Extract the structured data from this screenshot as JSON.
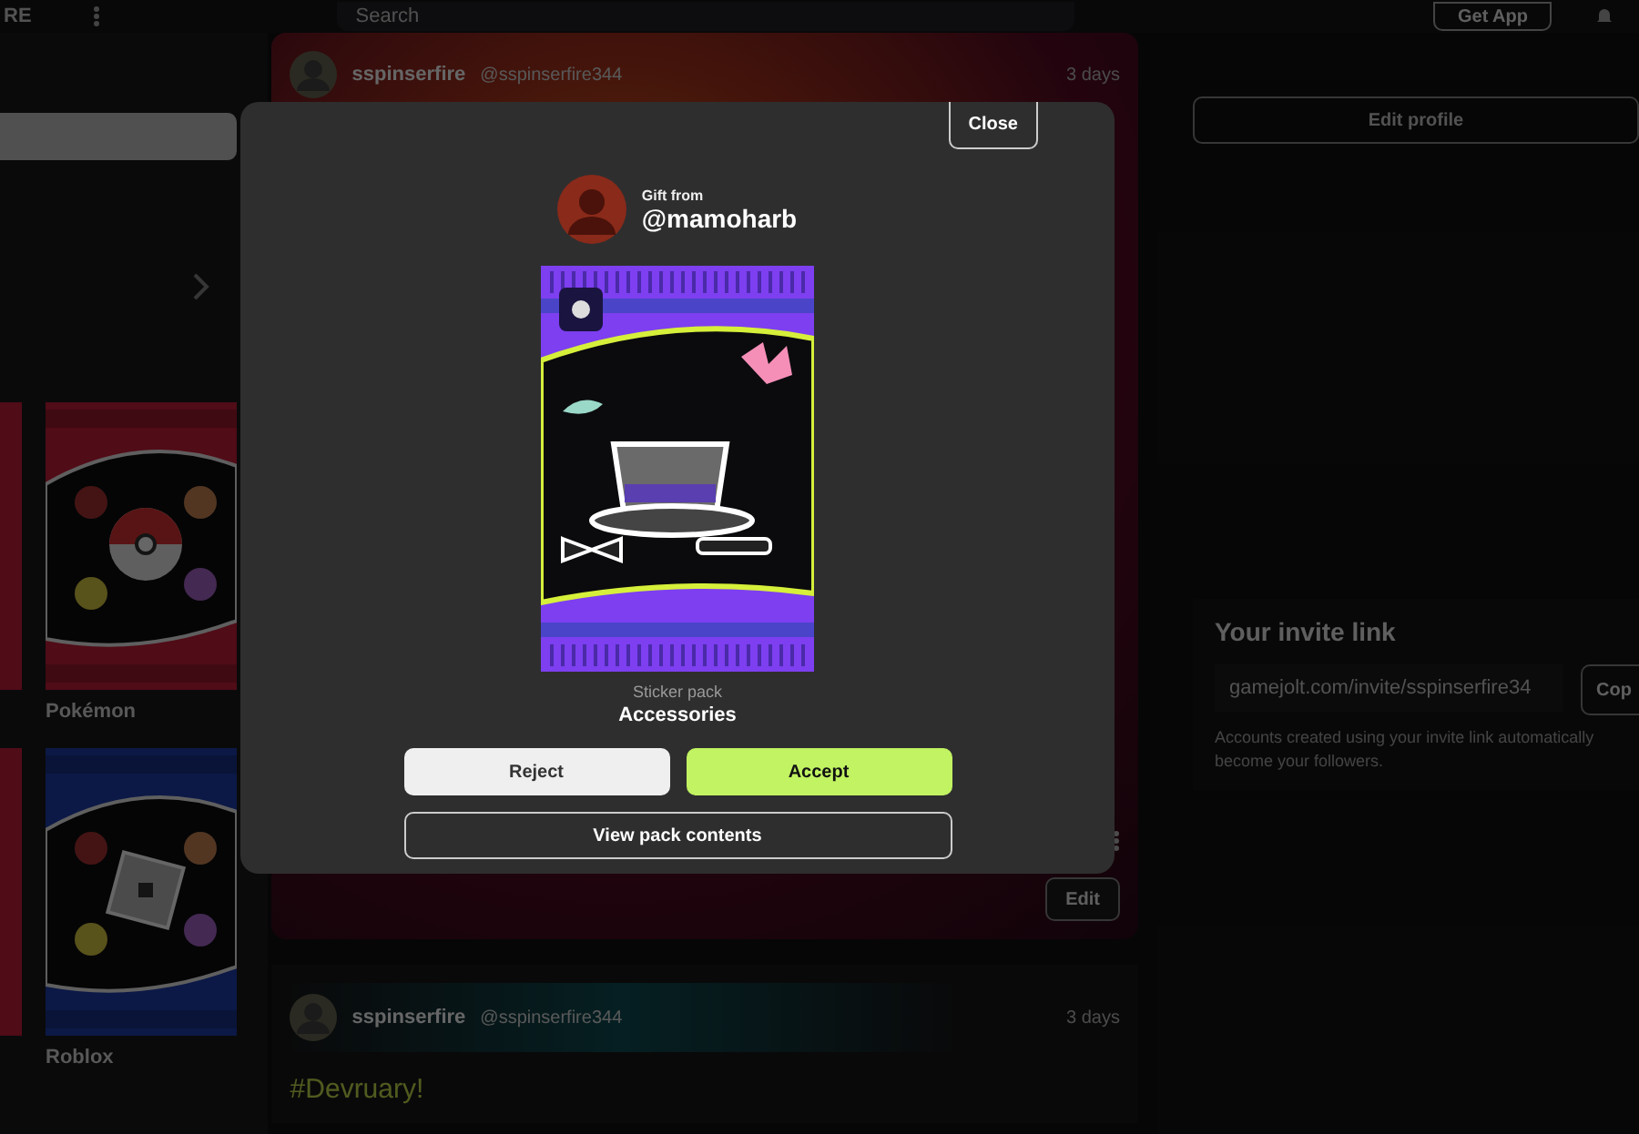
{
  "top_bar": {
    "brand_fragment": "RE",
    "search": {
      "placeholder": "Search"
    },
    "get_app": "Get App"
  },
  "sidebar": {
    "packs": [
      {
        "name": "Pokémon",
        "kind": "ball"
      },
      {
        "name": "Roblox",
        "kind": "block"
      }
    ]
  },
  "feed": {
    "posts": [
      {
        "username": "sspinserfire",
        "handle": "@sspinserfire344",
        "time": "3 days",
        "edit": "Edit"
      },
      {
        "username": "sspinserfire",
        "handle": "@sspinserfire344",
        "time": "3 days",
        "text": "#Devruary!"
      }
    ]
  },
  "profile": {
    "edit_profile": "Edit profile",
    "invite": {
      "title": "Your invite link",
      "link": "gamejolt.com/invite/sspinserfire34",
      "copy": "Cop",
      "note": "Accounts created using your invite link automatically become your followers."
    }
  },
  "modal": {
    "close": "Close",
    "gift_label": "Gift from",
    "sender": "@mamoharb",
    "pack_type": "Sticker pack",
    "pack_name": "Accessories",
    "buttons": [
      {
        "label": "Reject",
        "kind": "secondary"
      },
      {
        "label": "Accept",
        "kind": "primary"
      }
    ],
    "view_contents": "View pack contents"
  }
}
